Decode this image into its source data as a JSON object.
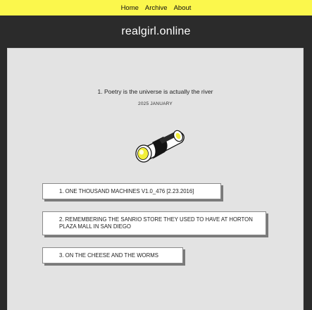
{
  "nav": {
    "items": [
      {
        "label": "Home"
      },
      {
        "label": "Archive"
      },
      {
        "label": "About"
      }
    ]
  },
  "site": {
    "title": "realgirl.online"
  },
  "post": {
    "title": "1. Poetry is the universe is actually the river",
    "date": "2025 JANUARY"
  },
  "links": [
    {
      "label": "1. ONE THOUSAND MACHINES V1.0_476 [2.23.2016]"
    },
    {
      "label": "2. REMEMBERING THE SANRIO STORE THEY USED TO HAVE AT HORTON PLAZA MALL IN SAN DIEGO"
    },
    {
      "label": "3. ON THE CHEESE AND THE WORMS"
    }
  ],
  "colors": {
    "topbar": "#fbf74c",
    "background": "#2b2b2b",
    "panel": "#e3e3e3",
    "illustration_accent": "#f2ef3a"
  },
  "icons": {
    "illustration": "log-scroll-illustration"
  }
}
